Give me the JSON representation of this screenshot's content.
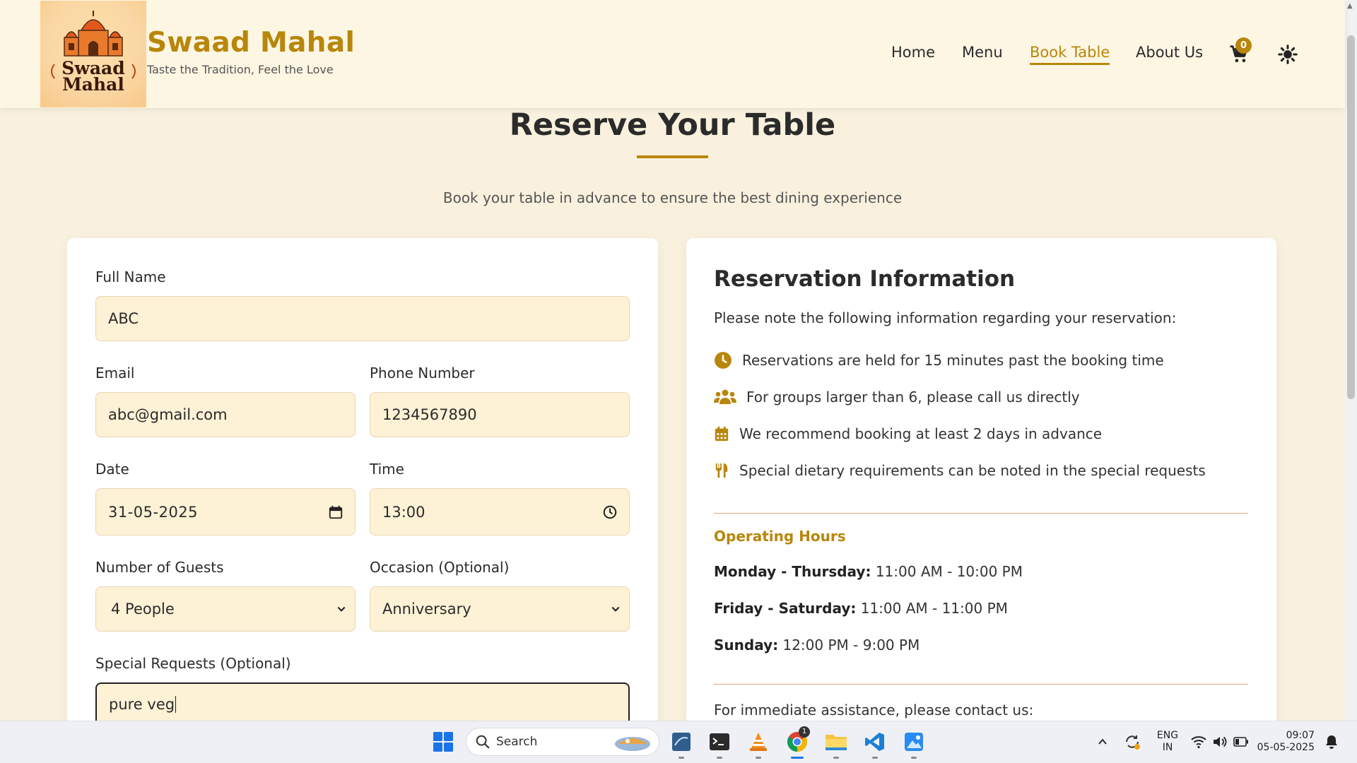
{
  "header": {
    "brand_title": "Swaad Mahal",
    "brand_tagline": "Taste the Tradition, Feel the Love",
    "logo_text_line1": "Swaad",
    "logo_text_line2": "Mahal",
    "nav": {
      "home": "Home",
      "menu": "Menu",
      "book_table": "Book Table",
      "about_us": "About Us"
    },
    "active_nav": "Book Table",
    "cart_count": "0"
  },
  "page": {
    "title": "Reserve Your Table",
    "subtitle": "Book your table in advance to ensure the best dining experience"
  },
  "form": {
    "full_name_label": "Full Name",
    "full_name_value": "ABC",
    "email_label": "Email",
    "email_value": "abc@gmail.com",
    "phone_label": "Phone Number",
    "phone_value": "1234567890",
    "date_label": "Date",
    "date_value": "31-05-2025",
    "time_label": "Time",
    "time_value": "13:00",
    "guests_label": "Number of Guests",
    "guests_value": "4 People",
    "occasion_label": "Occasion (Optional)",
    "occasion_value": "Anniversary",
    "requests_label": "Special Requests (Optional)",
    "requests_value": "pure veg"
  },
  "info": {
    "title": "Reservation Information",
    "intro": "Please note the following information regarding your reservation:",
    "items": [
      "Reservations are held for 15 minutes past the booking time",
      "For groups larger than 6, please call us directly",
      "We recommend booking at least 2 days in advance",
      "Special dietary requirements can be noted in the special requests"
    ],
    "hours_title": "Operating Hours",
    "hours": [
      {
        "day": "Monday - Thursday:",
        "time": "11:00 AM - 10:00 PM"
      },
      {
        "day": "Friday - Saturday:",
        "time": "11:00 AM - 11:00 PM"
      },
      {
        "day": "Sunday:",
        "time": "12:00 PM - 9:00 PM"
      }
    ],
    "assist": "For immediate assistance, please contact us:"
  },
  "taskbar": {
    "search_label": "Search",
    "lang_line1": "ENG",
    "lang_line2": "IN",
    "time": "09:07",
    "date": "05-05-2025",
    "chrome_badge": "1"
  },
  "colors": {
    "accent": "#b8860b",
    "page_bg": "#f9f1de",
    "header_bg": "#fdf6e3",
    "field_bg": "#fdf1d6"
  }
}
